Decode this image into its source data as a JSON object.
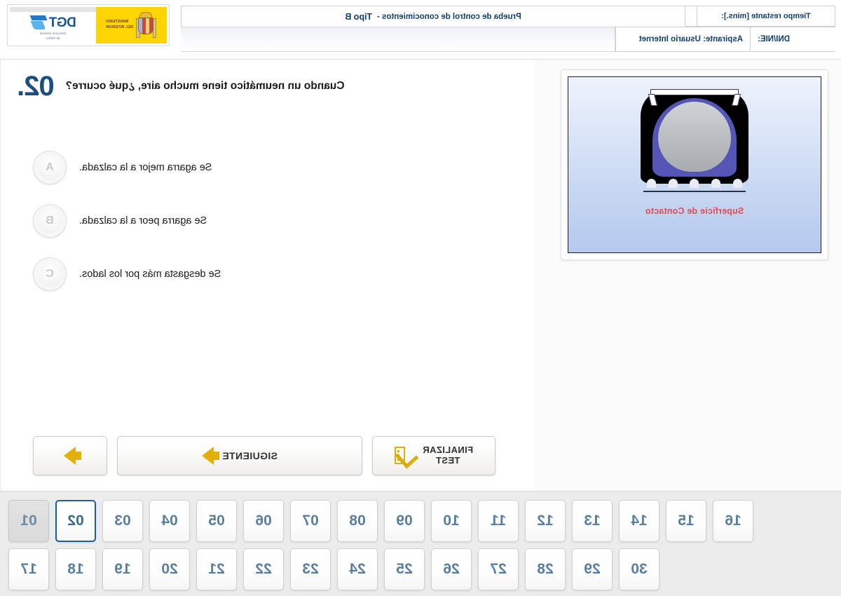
{
  "header": {
    "timer_label": "Tiempo restante [mins.]:",
    "timer_value": "",
    "exam_title": "Prueba de control de conocimientos  -",
    "exam_type": "Tipo  B",
    "applicant_label": "Aspirante: Usuario Internet",
    "dni_label": "DNI/NIE:",
    "logo": {
      "dgt_letters": "DGT",
      "dgt_subtitle_line1": "Dirección General",
      "dgt_subtitle_line2": "de Tráfico",
      "ministry_line1": "MINISTERIO",
      "ministry_line2": "DEL INTERIOR"
    }
  },
  "question": {
    "number": "02.",
    "text": "Cuando un neumático tiene mucho aire, ¿qué ocurre?",
    "answers": [
      {
        "key": "A",
        "text": "Se agarra mejor a la calzada."
      },
      {
        "key": "B",
        "text": "Se agarra peor a la calzada."
      },
      {
        "key": "C",
        "text": "Se desgasta más por los lados."
      }
    ]
  },
  "illustration": {
    "caption": "Superficie de Contacto"
  },
  "buttons": {
    "finalizar_line1": "FINALIZAR",
    "finalizar_line2": "TEST",
    "siguiente": "SIGUIENTE",
    "next_arrow": "next-arrow"
  },
  "navigation": {
    "current": "02",
    "answered": [
      "01"
    ],
    "row1": [
      "01",
      "02",
      "03",
      "04",
      "05",
      "06",
      "07",
      "08",
      "09",
      "10",
      "11",
      "12",
      "13",
      "14",
      "15",
      "16"
    ],
    "row2": [
      "17",
      "18",
      "19",
      "20",
      "21",
      "22",
      "23",
      "24",
      "25",
      "26",
      "27",
      "28",
      "29",
      "30"
    ]
  },
  "colors": {
    "accent_blue": "#1b5fa0",
    "heading_blue": "#123f6e",
    "caption_red": "#e04b52",
    "gold": "#e3b007",
    "ministry_yellow": "#ffd400"
  }
}
